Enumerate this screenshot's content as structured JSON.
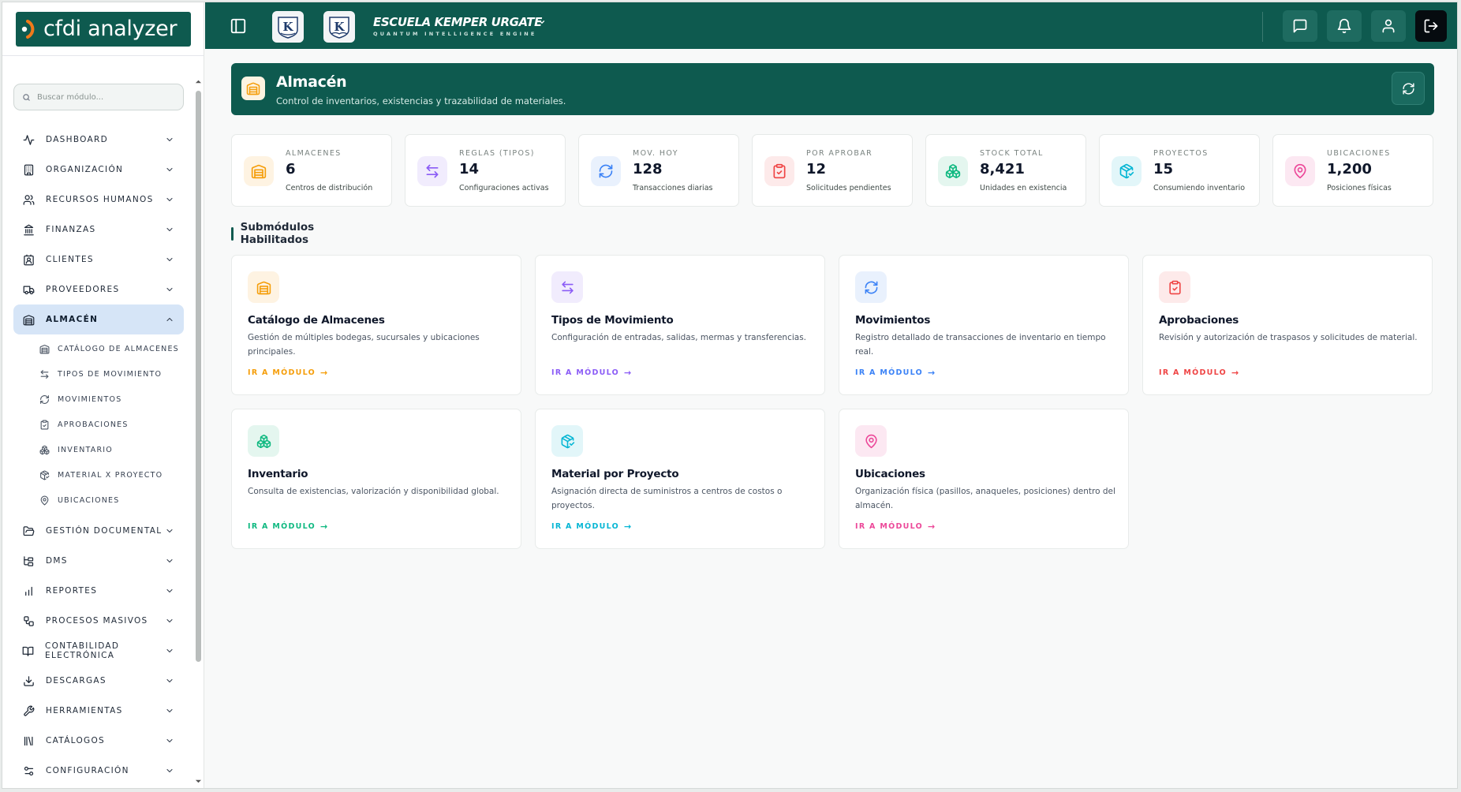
{
  "app": {
    "logo_text": "cfdi analyzer"
  },
  "sidebar": {
    "search_placeholder": "Buscar módulo...",
    "items": [
      {
        "key": "dashboard",
        "label": "DASHBOARD",
        "icon": "activity-icon"
      },
      {
        "key": "organizacion",
        "label": "ORGANIZACIÓN",
        "icon": "building-icon"
      },
      {
        "key": "rrhh",
        "label": "RECURSOS HUMANOS",
        "icon": "users-icon"
      },
      {
        "key": "finanzas",
        "label": "FINANZAS",
        "icon": "bank-icon"
      },
      {
        "key": "clientes",
        "label": "CLIENTES",
        "icon": "contact-icon"
      },
      {
        "key": "proveedores",
        "label": "PROVEEDORES",
        "icon": "truck-icon"
      },
      {
        "key": "almacen",
        "label": "ALMACÉN",
        "icon": "warehouse-icon"
      },
      {
        "key": "gestion-documental",
        "label": "GESTIÓN DOCUMENTAL",
        "icon": "folder-icon"
      },
      {
        "key": "dms",
        "label": "DMS",
        "icon": "tree-icon"
      },
      {
        "key": "reportes",
        "label": "REPORTES",
        "icon": "bar-chart-icon"
      },
      {
        "key": "procesos-masivos",
        "label": "PROCESOS MASIVOS",
        "icon": "workflow-icon"
      },
      {
        "key": "contabilidad",
        "label": "CONTABILIDAD ELECTRÓNICA",
        "icon": "book-icon"
      },
      {
        "key": "descargas",
        "label": "DESCARGAS",
        "icon": "download-icon"
      },
      {
        "key": "herramientas",
        "label": "HERRAMIENTAS",
        "icon": "wrench-icon"
      },
      {
        "key": "catalogos",
        "label": "CATÁLOGOS",
        "icon": "library-icon"
      },
      {
        "key": "configuracion",
        "label": "CONFIGURACIÓN",
        "icon": "settings-sliders-icon"
      }
    ],
    "almacen_sub": [
      {
        "label": "CATÁLOGO DE ALMACENES",
        "icon": "warehouse-icon"
      },
      {
        "label": "TIPOS DE MOVIMIENTO",
        "icon": "arrows-swap-icon"
      },
      {
        "label": "MOVIMIENTOS",
        "icon": "refresh-icon"
      },
      {
        "label": "APROBACIONES",
        "icon": "clipboard-check-icon"
      },
      {
        "label": "INVENTARIO",
        "icon": "boxes-icon"
      },
      {
        "label": "MATERIAL X PROYECTO",
        "icon": "package-check-icon"
      },
      {
        "label": "UBICACIONES",
        "icon": "map-pin-icon"
      }
    ]
  },
  "topbar": {
    "school_name": "ESCUELA KEMPER URGATE",
    "school_tagline": "QUANTUM INTELLIGENCE ENGINE",
    "brand_letter": "K"
  },
  "banner": {
    "title": "Almacén",
    "subtitle": "Control de inventarios, existencias y trazabilidad de materiales."
  },
  "stats": [
    {
      "label": "ALMACENES",
      "value": "6",
      "desc": "Centros de distribución",
      "color": "#f59e0b",
      "bg": "#fef3e2",
      "icon": "warehouse-icon"
    },
    {
      "label": "REGLAS (TIPOS)",
      "value": "14",
      "desc": "Configuraciones activas",
      "color": "#8b5cf6",
      "bg": "#f1ecfd",
      "icon": "arrows-swap-icon"
    },
    {
      "label": "MOV. HOY",
      "value": "128",
      "desc": "Transacciones diarias",
      "color": "#3b82f6",
      "bg": "#e9f1fd",
      "icon": "refresh-icon"
    },
    {
      "label": "POR APROBAR",
      "value": "12",
      "desc": "Solicitudes pendientes",
      "color": "#ef4444",
      "bg": "#fdeaea",
      "icon": "clipboard-check-icon"
    },
    {
      "label": "STOCK TOTAL",
      "value": "8,421",
      "desc": "Unidades en existencia",
      "color": "#10b981",
      "bg": "#e4f6ef",
      "icon": "boxes-icon"
    },
    {
      "label": "PROYECTOS",
      "value": "15",
      "desc": "Consumiendo inventario",
      "color": "#06b6d4",
      "bg": "#e2f6f9",
      "icon": "package-check-icon"
    },
    {
      "label": "UBICACIONES",
      "value": "1,200",
      "desc": "Posiciones físicas",
      "color": "#ec4899",
      "bg": "#fce8f2",
      "icon": "map-pin-icon"
    }
  ],
  "section": {
    "title": "Submódulos Habilitados"
  },
  "modules": [
    {
      "title": "Catálogo de Almacenes",
      "desc": "Gestión de múltiples bodegas, sucursales y ubicaciones principales.",
      "link": "IR A MÓDULO",
      "color": "#f59e0b",
      "bg": "#fef3e2",
      "icon": "warehouse-icon"
    },
    {
      "title": "Tipos de Movimiento",
      "desc": "Configuración de entradas, salidas, mermas y transferencias.",
      "link": "IR A MÓDULO",
      "color": "#8b5cf6",
      "bg": "#f1ecfd",
      "icon": "arrows-swap-icon"
    },
    {
      "title": "Movimientos",
      "desc": "Registro detallado de transacciones de inventario en tiempo real.",
      "link": "IR A MÓDULO",
      "color": "#3b82f6",
      "bg": "#e9f1fd",
      "icon": "refresh-icon"
    },
    {
      "title": "Aprobaciones",
      "desc": "Revisión y autorización de traspasos y solicitudes de material.",
      "link": "IR A MÓDULO",
      "color": "#ef4444",
      "bg": "#fdeaea",
      "icon": "clipboard-check-icon"
    },
    {
      "title": "Inventario",
      "desc": "Consulta de existencias, valorización y disponibilidad global.",
      "link": "IR A MÓDULO",
      "color": "#10b981",
      "bg": "#e4f6ef",
      "icon": "boxes-icon"
    },
    {
      "title": "Material por Proyecto",
      "desc": "Asignación directa de suministros a centros de costos o proyectos.",
      "link": "IR A MÓDULO",
      "color": "#06b6d4",
      "bg": "#e2f6f9",
      "icon": "package-check-icon"
    },
    {
      "title": "Ubicaciones",
      "desc": "Organización física (pasillos, anaqueles, posiciones) dentro del almacén.",
      "link": "IR A MÓDULO",
      "color": "#ec4899",
      "bg": "#fce8f2",
      "icon": "map-pin-icon"
    }
  ]
}
